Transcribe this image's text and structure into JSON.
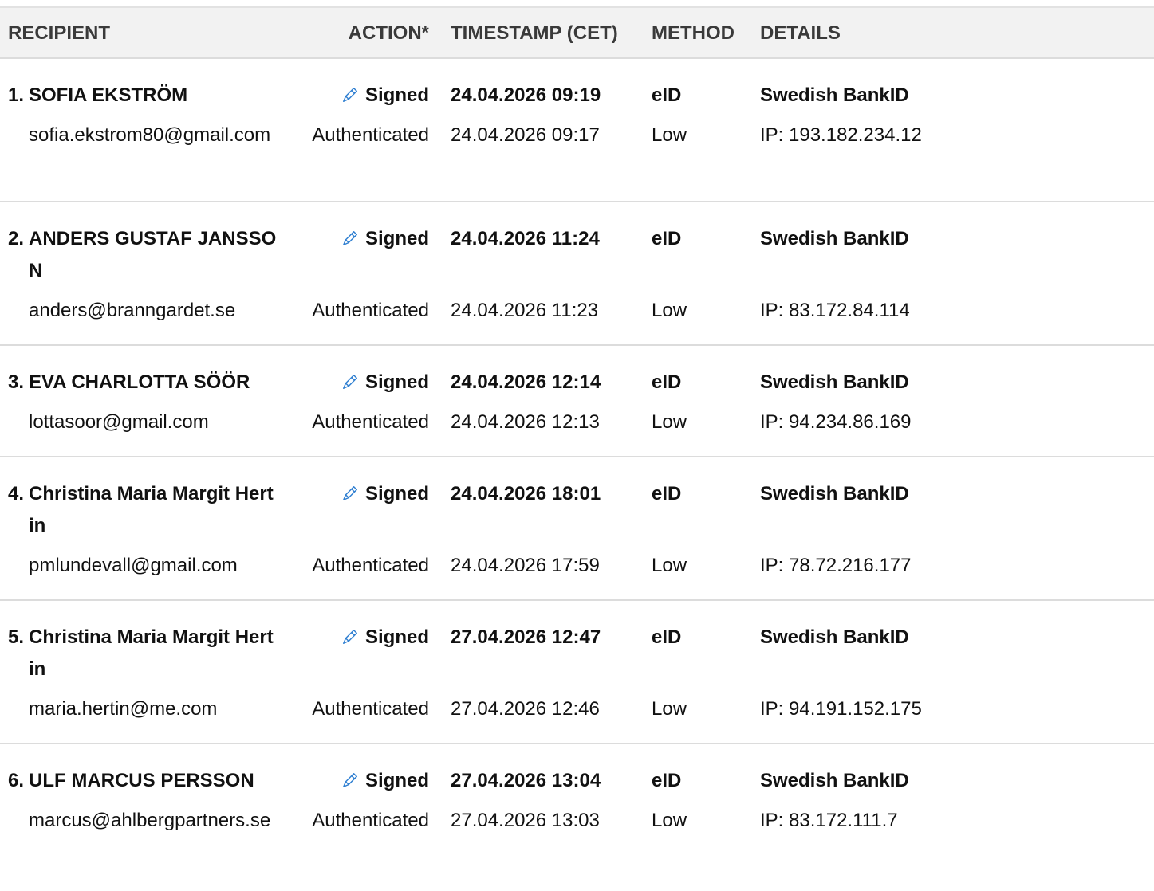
{
  "header": {
    "recipient": "RECIPIENT",
    "action": "ACTION*",
    "timestamp": "TIMESTAMP (CET)",
    "method": "METHOD",
    "details": "DETAILS"
  },
  "rows": [
    {
      "number": "1.",
      "name": "SOFIA EKSTRÖM",
      "email": "sofia.ekstrom80@gmail.com",
      "signed_action": "Signed",
      "signed_timestamp": "24.04.2026 09:19",
      "signed_method": "eID",
      "signed_details": "Swedish BankID",
      "auth_action": "Authenticated",
      "auth_timestamp": "24.04.2026 09:17",
      "auth_method": "Low",
      "auth_details": "IP: 193.182.234.12"
    },
    {
      "number": "2.",
      "name": "ANDERS GUSTAF JANSSON",
      "email": "anders@branngardet.se",
      "signed_action": "Signed",
      "signed_timestamp": "24.04.2026 11:24",
      "signed_method": "eID",
      "signed_details": "Swedish BankID",
      "auth_action": "Authenticated",
      "auth_timestamp": "24.04.2026 11:23",
      "auth_method": "Low",
      "auth_details": "IP: 83.172.84.114"
    },
    {
      "number": "3.",
      "name": "EVA CHARLOTTA SÖÖR",
      "email": "lottasoor@gmail.com",
      "signed_action": "Signed",
      "signed_timestamp": "24.04.2026 12:14",
      "signed_method": "eID",
      "signed_details": "Swedish BankID",
      "auth_action": "Authenticated",
      "auth_timestamp": "24.04.2026 12:13",
      "auth_method": "Low",
      "auth_details": "IP: 94.234.86.169"
    },
    {
      "number": "4.",
      "name": "Christina Maria Margit Hertin",
      "email": "pmlundevall@gmail.com",
      "signed_action": "Signed",
      "signed_timestamp": "24.04.2026 18:01",
      "signed_method": "eID",
      "signed_details": "Swedish BankID",
      "auth_action": "Authenticated",
      "auth_timestamp": "24.04.2026 17:59",
      "auth_method": "Low",
      "auth_details": "IP: 78.72.216.177"
    },
    {
      "number": "5.",
      "name": "Christina Maria Margit Hertin",
      "email": "maria.hertin@me.com",
      "signed_action": "Signed",
      "signed_timestamp": "27.04.2026 12:47",
      "signed_method": "eID",
      "signed_details": "Swedish BankID",
      "auth_action": "Authenticated",
      "auth_timestamp": "27.04.2026 12:46",
      "auth_method": "Low",
      "auth_details": "IP: 94.191.152.175"
    },
    {
      "number": "6.",
      "name": "ULF MARCUS PERSSON",
      "email": "marcus@ahlbergpartners.se",
      "signed_action": "Signed",
      "signed_timestamp": "27.04.2026 13:04",
      "signed_method": "eID",
      "signed_details": "Swedish BankID",
      "auth_action": "Authenticated",
      "auth_timestamp": "27.04.2026 13:03",
      "auth_method": "Low",
      "auth_details": "IP: 83.172.111.7"
    }
  ],
  "icons": {
    "signed": "pen-icon"
  },
  "colors": {
    "pen_icon": "#2f7fd1",
    "header_bg": "#f2f2f2",
    "divider": "#dcdcdc"
  }
}
